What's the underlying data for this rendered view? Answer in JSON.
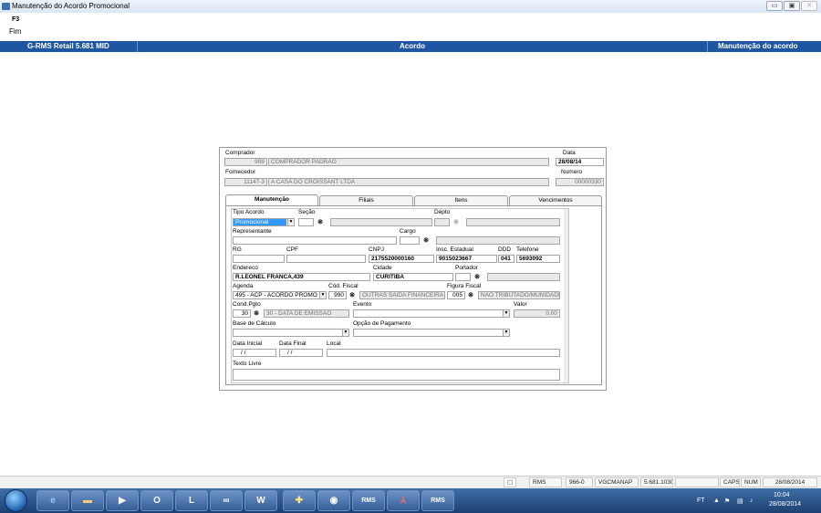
{
  "window": {
    "title": "Manutenção do Acordo Promocional",
    "minimize_glyph": "▭",
    "maximize_glyph": "▣",
    "close_glyph": "✕"
  },
  "toolbar": {
    "fkey": "F3",
    "fkey_label": "Fim"
  },
  "header": {
    "app_name": "G-RMS Retail 5.681 MID",
    "section": "Acordo",
    "screen": "Manutenção do acordo"
  },
  "form": {
    "comprador_label": "Comprador",
    "comprador_code": "999",
    "comprador_name": "COMPRADOR PADRAO",
    "data_label": "Data",
    "data_value": "28/08/14",
    "fornecedor_label": "Fornecedor",
    "fornecedor_code": "11147-3",
    "fornecedor_name": "A CASA DO CROISSANT LTDA",
    "numero_label": "Numero",
    "numero_value": "00000330"
  },
  "tabs": [
    {
      "label": "Manutenção",
      "active": true
    },
    {
      "label": "Filiais",
      "active": false
    },
    {
      "label": "Itens",
      "active": false
    },
    {
      "label": "Vencimentos",
      "active": false
    }
  ],
  "fields": {
    "tipo_acordo_label": "Tipo Acordo",
    "tipo_acordo_value": "Promocional",
    "secao_label": "Seção",
    "depto_label": "Depto",
    "representante_label": "Representante",
    "cargo_label": "Cargo",
    "rg_label": "RG",
    "cpf_label": "CPF",
    "cnpj_label": "CNPJ",
    "cnpj_value": "2175520000160",
    "insc_label": "Insc. Estadual",
    "insc_value": "9015023667",
    "ddd_label": "DDD",
    "ddd_value": "041",
    "telefone_label": "Telefone",
    "telefone_value": "5693092",
    "endereco_label": "Endereco",
    "endereco_value": "R.LEONEL FRANCA,439",
    "cidade_label": "Cidade",
    "cidade_value": "CURITIBA",
    "portador_label": "Portador",
    "agenda_label": "Agenda",
    "agenda_value": "495 - ACP - ACORDO PROMO",
    "cod_fiscal_label": "Cód. Fiscal",
    "cod_fiscal_code": "990",
    "cod_fiscal_desc": "OUTRAS SAIDA FINANCEIRA",
    "figura_label": "Figura Fiscal",
    "figura_code": "005",
    "figura_desc": "NAO TRIBUTADO/MUNIDADE",
    "cond_pgto_label": "Cond.Pgto",
    "cond_pgto_code": "30",
    "cond_pgto_desc": "30 - DATA DE EMISSAO",
    "evento_label": "Evento",
    "valor_label": "Valor",
    "valor_value": "0,00",
    "base_label": "Base de Cálculo",
    "opcao_label": "Opção de Pagamento",
    "data_inicial_label": "Data Inicial",
    "data_inicial_value": "/ /",
    "data_final_label": "Data Final",
    "data_final_value": "/ /",
    "local_label": "Local",
    "texto_livre_label": "Texto Livre"
  },
  "statusbar": {
    "module": "RMS",
    "code": "966-0",
    "user": "VGCMANAP",
    "version": "5.681.1030",
    "caps": "CAPS",
    "num": "NUM",
    "date": "28/08/2014"
  },
  "taskbar": {
    "rms1": "RMS",
    "rms2": "RMS",
    "lang": "FT",
    "time": "10:04",
    "date": "28/08/2014"
  },
  "colors": {
    "header_band": "#1f56a4",
    "selected_item": "#3399ff"
  },
  "icons": [
    "binoculars-icon",
    "dropdown-arrow-icon",
    "windows-start-icon",
    "ie-icon",
    "folder-icon",
    "outlook-icon",
    "lync-icon",
    "word-icon",
    "acrobat-icon"
  ]
}
